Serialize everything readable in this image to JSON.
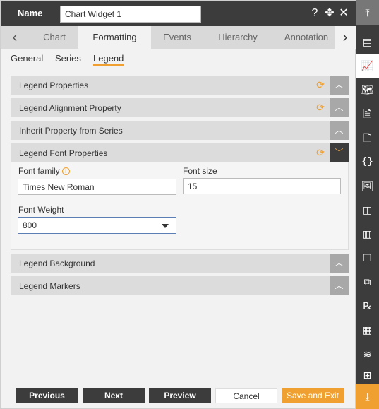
{
  "header": {
    "name_label": "Name",
    "name_value": "Chart Widget 1",
    "icons": [
      "help-icon",
      "move-icon",
      "close-icon"
    ]
  },
  "tabs": {
    "items": [
      "Chart",
      "Formatting",
      "Events",
      "Hierarchy",
      "Annotation"
    ],
    "active": "Formatting"
  },
  "subtabs": {
    "items": [
      "General",
      "Series",
      "Legend"
    ],
    "active": "Legend"
  },
  "sections": {
    "legend_properties": "Legend Properties",
    "legend_alignment": "Legend Alignment Property",
    "inherit_series": "Inherit Property from Series",
    "legend_font": "Legend Font Properties",
    "legend_background": "Legend Background",
    "legend_markers": "Legend Markers"
  },
  "font": {
    "family_label": "Font family",
    "family_value": "Times New Roman",
    "size_label": "Font size",
    "size_value": "15",
    "weight_label": "Font Weight",
    "weight_value": "800"
  },
  "footer": {
    "previous": "Previous",
    "next": "Next",
    "preview": "Preview",
    "cancel": "Cancel",
    "save_exit": "Save and Exit"
  },
  "colors": {
    "accent": "#f0a030",
    "dark": "#3c3c3c"
  }
}
